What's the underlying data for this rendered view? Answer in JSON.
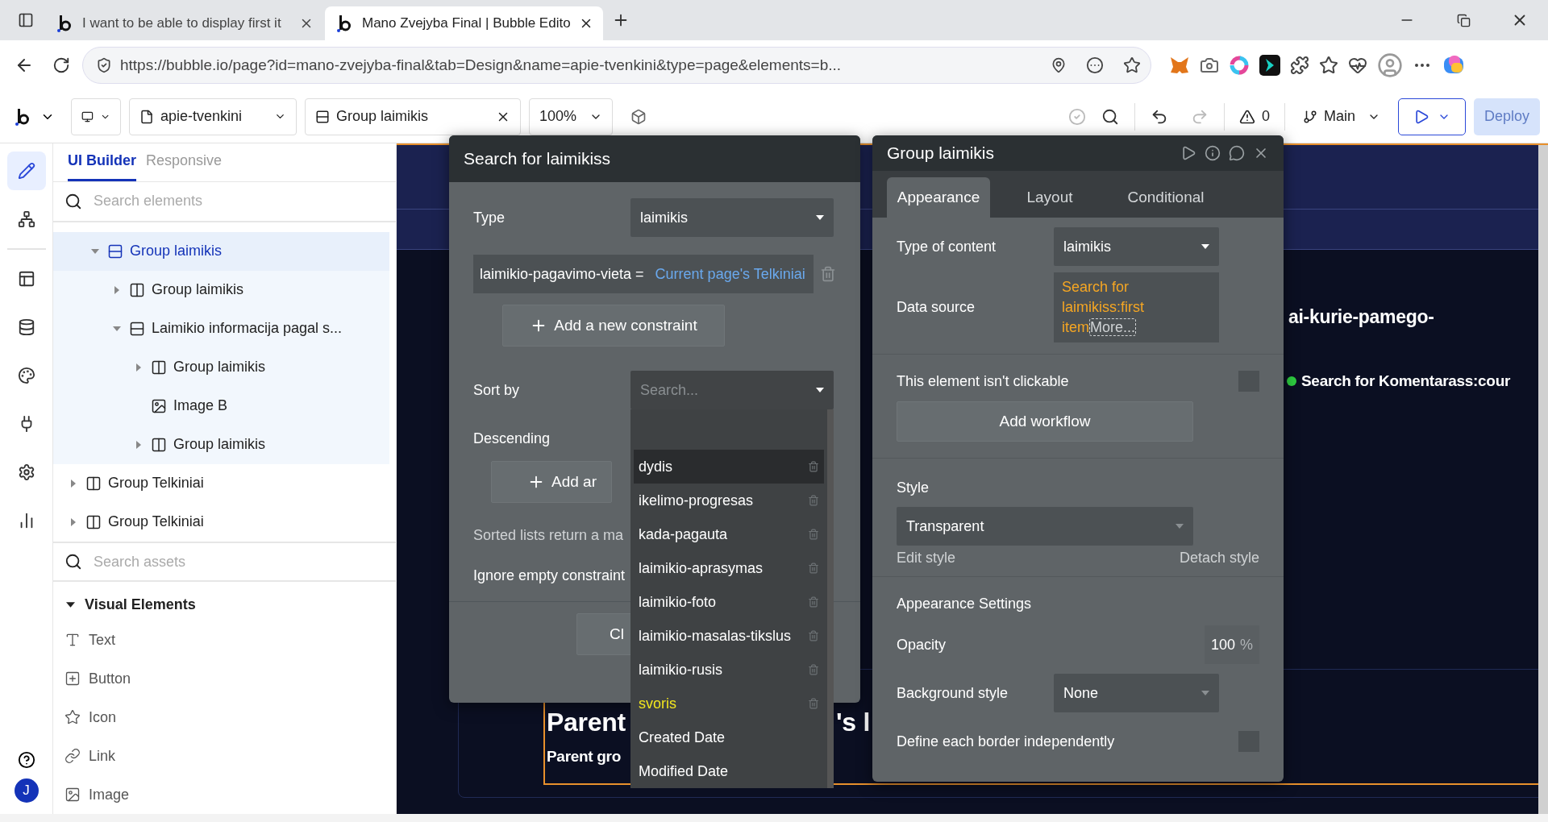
{
  "browser": {
    "tabs": [
      {
        "title": "I want to be able to display first it",
        "selected": false
      },
      {
        "title": "Mano Zvejyba Final | Bubble Edito",
        "selected": true
      }
    ],
    "url": "https://bubble.io/page?id=mano-zvejyba-final&tab=Design&name=apie-tvenkini&type=page&elements=b..."
  },
  "toolbar": {
    "page": "apie-tvenkini",
    "element": "Group laimikis",
    "zoom": "100%",
    "issues": "0",
    "branch": "Main",
    "deploy": {
      "label": "Deploy",
      "disabled": true
    }
  },
  "rail": {
    "items": [
      {
        "kind": "design",
        "selected": true
      },
      {
        "kind": "structure",
        "selected": false
      },
      {
        "kind": "layout",
        "selected": false
      },
      {
        "kind": "data",
        "selected": false
      },
      {
        "kind": "styles",
        "selected": false
      },
      {
        "kind": "plugins",
        "selected": false
      },
      {
        "kind": "settings",
        "selected": false
      },
      {
        "kind": "logs",
        "selected": false
      }
    ],
    "avatar": "J"
  },
  "left_panel": {
    "tabs": [
      {
        "label": "UI Builder",
        "selected": true
      },
      {
        "label": "Responsive",
        "selected": false
      }
    ],
    "search": {
      "placeholder": "Search elements"
    },
    "tree": [
      {
        "children": [
          {
            "label": "Group laimikis",
            "kind": "rows",
            "expanded": true,
            "selected": true,
            "children": [
              {
                "label": "Group laimikis",
                "kind": "columns",
                "expanded": false,
                "selected": false
              },
              {
                "label": "Laimikio informacija pagal s...",
                "kind": "rows",
                "expanded": true,
                "selected": false,
                "children": [
                  {
                    "label": "Group laimikis",
                    "kind": "columns",
                    "expanded": false,
                    "selected": false
                  },
                  {
                    "label": "Image B",
                    "kind": "image",
                    "selected": false
                  },
                  {
                    "label": "Group laimikis",
                    "kind": "columns",
                    "expanded": false,
                    "selected": false
                  }
                ]
              }
            ]
          }
        ]
      },
      {
        "label": "Group Telkiniai",
        "kind": "columns",
        "expanded": false,
        "selected": false
      },
      {
        "label": "Group Telkiniai",
        "kind": "columns",
        "expanded": false,
        "selected": false
      }
    ],
    "assets_search": {
      "placeholder": "Search assets"
    },
    "category": {
      "label": "Visual Elements",
      "expanded": true
    },
    "assets": [
      {
        "label": "Text",
        "kind": "text"
      },
      {
        "label": "Button",
        "kind": "button"
      },
      {
        "label": "Icon",
        "kind": "icon"
      },
      {
        "label": "Link",
        "kind": "link"
      },
      {
        "label": "Image",
        "kind": "image"
      }
    ]
  },
  "search_popup": {
    "title": "Search for laimikiss",
    "type_label": "Type",
    "type_value": "laimikis",
    "constraint": {
      "field": "laimikio-pagavimo-vieta =",
      "value": "Current page's Telkiniai"
    },
    "add_constraint": "Add a new constraint",
    "sort_label": "Sort by",
    "sort_placeholder": "Search...",
    "descending_label": "Descending",
    "add_sort": "Add ar",
    "note": "Sorted lists return a ma",
    "ignore_label": "Ignore empty constraint",
    "close": "Cl",
    "sort_options": [
      {
        "label": "dydis",
        "active": true,
        "marked": false,
        "deletable": true
      },
      {
        "label": "ikelimo-progresas",
        "active": false,
        "marked": false,
        "deletable": true
      },
      {
        "label": "kada-pagauta",
        "active": false,
        "marked": false,
        "deletable": true
      },
      {
        "label": "laimikio-aprasymas",
        "active": false,
        "marked": false,
        "deletable": true
      },
      {
        "label": "laimikio-foto",
        "active": false,
        "marked": false,
        "deletable": true
      },
      {
        "label": "laimikio-masalas-tikslus",
        "active": false,
        "marked": false,
        "deletable": true
      },
      {
        "label": "laimikio-rusis",
        "active": false,
        "marked": false,
        "deletable": true
      },
      {
        "label": "svoris",
        "active": false,
        "marked": true,
        "deletable": true
      },
      {
        "label": "Created Date",
        "active": false,
        "marked": false,
        "deletable": false
      },
      {
        "label": "Modified Date",
        "active": false,
        "marked": false,
        "deletable": false
      }
    ]
  },
  "property_editor": {
    "title": "Group laimikis",
    "tabs": [
      {
        "label": "Appearance",
        "selected": true
      },
      {
        "label": "Layout",
        "selected": false
      },
      {
        "label": "Conditional",
        "selected": false
      }
    ],
    "type_label": "Type of content",
    "type_value": "laimikis",
    "source_label": "Data source",
    "source_value": "Search for laimikiss:first item",
    "source_more": "More...",
    "clickable_label": "This element isn't clickable",
    "clickable_checked": false,
    "workflow_button": "Add workflow",
    "style_label": "Style",
    "style_value": "Transparent",
    "edit_style": "Edit style",
    "detach_style": "Detach style",
    "settings_heading": "Appearance Settings",
    "opacity_label": "Opacity",
    "opacity_value": "100",
    "opacity_unit": "%",
    "background_label": "Background style",
    "background_value": "None",
    "border_label": "Define each border independently",
    "border_checked": false
  },
  "canvas": {
    "fragments": [
      {
        "kind": "label",
        "text": "ai-kurie-pamego-"
      },
      {
        "kind": "status",
        "text": "Search for Komentarass:cour",
        "color": "#2ecc40"
      },
      {
        "kind": "title",
        "text": "Parent"
      },
      {
        "kind": "title-end",
        "text": "'s l"
      },
      {
        "kind": "subtitle",
        "text": "Parent gro"
      }
    ]
  }
}
